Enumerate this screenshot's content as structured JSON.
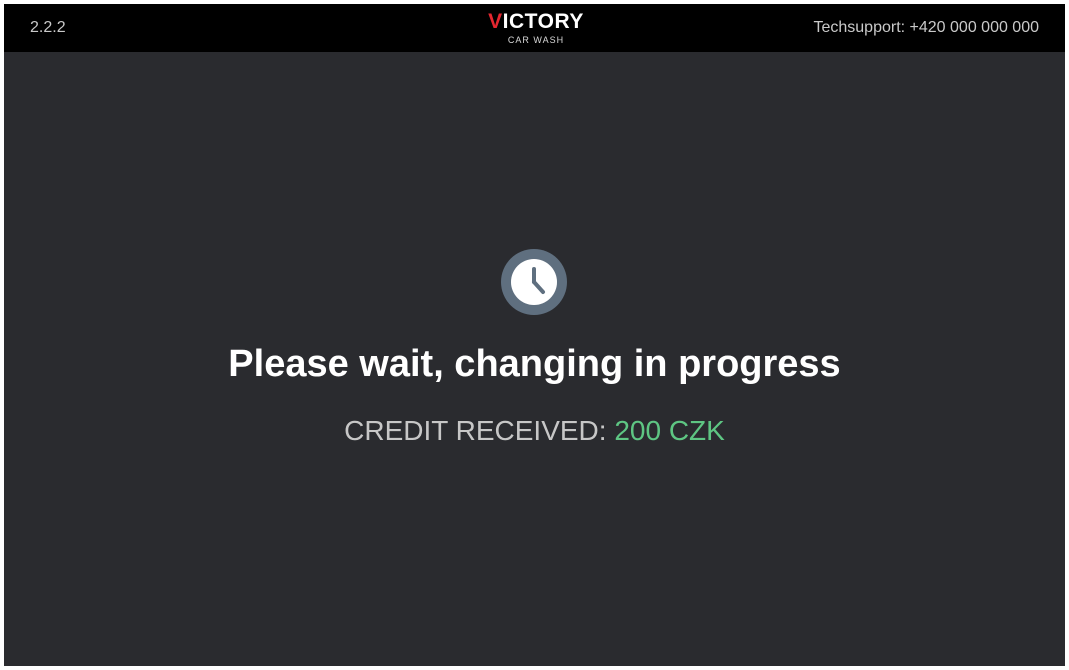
{
  "header": {
    "version": "2.2.2",
    "brand_name_initial": "V",
    "brand_name_rest": "ICTORY",
    "brand_tagline": "CAR WASH",
    "techsupport": "Techsupport: +420 000 000 000"
  },
  "main": {
    "status_icon": "clock-icon",
    "message": "Please wait, changing in progress",
    "credit_label": "CREDIT RECEIVED:",
    "credit_amount": "200 CZK"
  },
  "colors": {
    "background": "#2a2b2f",
    "topbar": "#000000",
    "brand_accent": "#e3262f",
    "credit_amount": "#5ec683",
    "icon_ring": "#5f6f7f"
  }
}
